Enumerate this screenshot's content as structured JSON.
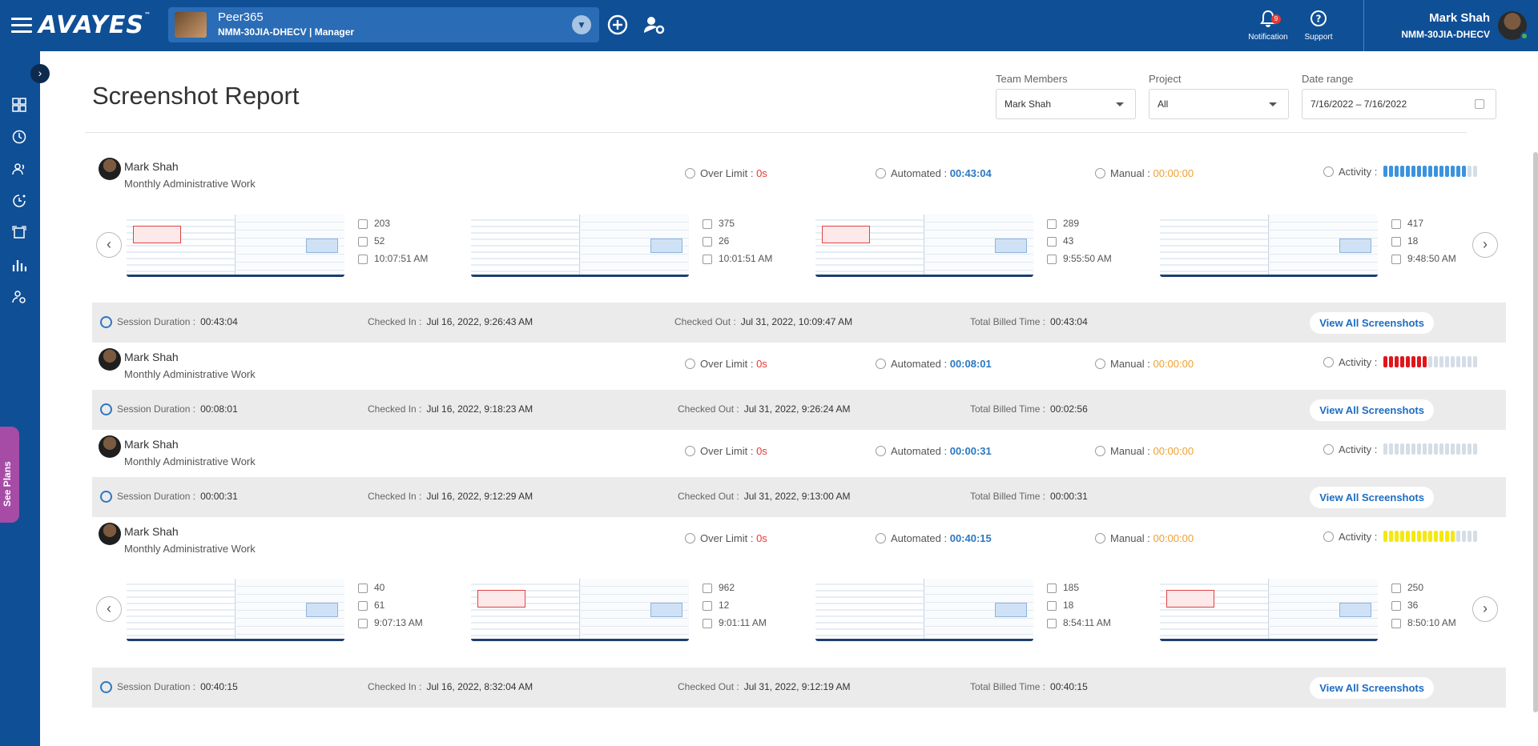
{
  "header": {
    "logo": "AVAYES",
    "logo_tm": "™",
    "workspace_name": "Peer365",
    "workspace_sub": "NMM-30JIA-DHECV | Manager",
    "notification_label": "Notification",
    "notification_count": "9",
    "support_label": "Support",
    "user_name": "Mark Shah",
    "user_code": "NMM-30JIA-DHECV"
  },
  "sidebar": {
    "see_plans": "See Plans",
    "icons": [
      "dashboard-icon",
      "clock-icon",
      "team-icon",
      "timer-icon",
      "screenshot-icon",
      "chart-icon",
      "user-settings-icon"
    ]
  },
  "page": {
    "title": "Screenshot Report",
    "filters": {
      "team_label": "Team Members",
      "team_value": "Mark Shah",
      "project_label": "Project",
      "project_value": "All",
      "date_label": "Date range",
      "date_value": "7/16/2022 – 7/16/2022"
    }
  },
  "labels": {
    "over_limit": "Over Limit : ",
    "automated": "Automated : ",
    "manual": "Manual : ",
    "activity": "Activity :",
    "session_duration": "Session Duration :",
    "checked_in": "Checked In :",
    "checked_out": "Checked Out :",
    "total_billed": "Total Billed Time :",
    "view_all": "View All Screenshots"
  },
  "records": [
    {
      "name": "Mark Shah",
      "project": "Monthly Administrative Work",
      "over_limit": "0s",
      "automated": "00:43:04",
      "manual": "00:00:00",
      "activity_color": "#3b93e0",
      "activity_level": 0.9,
      "screens": [
        {
          "keys": "203",
          "clicks": "52",
          "time": "10:07:51 AM"
        },
        {
          "keys": "375",
          "clicks": "26",
          "time": "10:01:51 AM"
        },
        {
          "keys": "289",
          "clicks": "43",
          "time": "9:55:50 AM"
        },
        {
          "keys": "417",
          "clicks": "18",
          "time": "9:48:50 AM"
        }
      ],
      "session": {
        "duration": "00:43:04",
        "checked_in": "Jul 16, 2022, 9:26:43 AM",
        "checked_out": "Jul 31, 2022, 10:09:47 AM",
        "billed": "00:43:04"
      }
    },
    {
      "name": "Mark Shah",
      "project": "Monthly Administrative Work",
      "over_limit": "0s",
      "automated": "00:08:01",
      "manual": "00:00:00",
      "activity_color": "#e0161b",
      "activity_level": 0.45,
      "screens": [],
      "session": {
        "duration": "00:08:01",
        "checked_in": "Jul 16, 2022, 9:18:23 AM",
        "checked_out": "Jul 31, 2022, 9:26:24 AM",
        "billed": "00:02:56"
      }
    },
    {
      "name": "Mark Shah",
      "project": "Monthly Administrative Work",
      "over_limit": "0s",
      "automated": "00:00:31",
      "manual": "00:00:00",
      "activity_color": "#d5dde6",
      "activity_level": 0,
      "screens": [],
      "session": {
        "duration": "00:00:31",
        "checked_in": "Jul 16, 2022, 9:12:29 AM",
        "checked_out": "Jul 31, 2022, 9:13:00 AM",
        "billed": "00:00:31"
      }
    },
    {
      "name": "Mark Shah",
      "project": "Monthly Administrative Work",
      "over_limit": "0s",
      "automated": "00:40:15",
      "manual": "00:00:00",
      "activity_color": "#f5e80f",
      "activity_level": 0.75,
      "screens": [
        {
          "keys": "40",
          "clicks": "61",
          "time": "9:07:13 AM"
        },
        {
          "keys": "962",
          "clicks": "12",
          "time": "9:01:11 AM"
        },
        {
          "keys": "185",
          "clicks": "18",
          "time": "8:54:11 AM"
        },
        {
          "keys": "250",
          "clicks": "36",
          "time": "8:50:10 AM"
        }
      ],
      "session": {
        "duration": "00:40:15",
        "checked_in": "Jul 16, 2022, 8:32:04 AM",
        "checked_out": "Jul 31, 2022, 9:12:19 AM",
        "billed": "00:40:15"
      }
    }
  ]
}
